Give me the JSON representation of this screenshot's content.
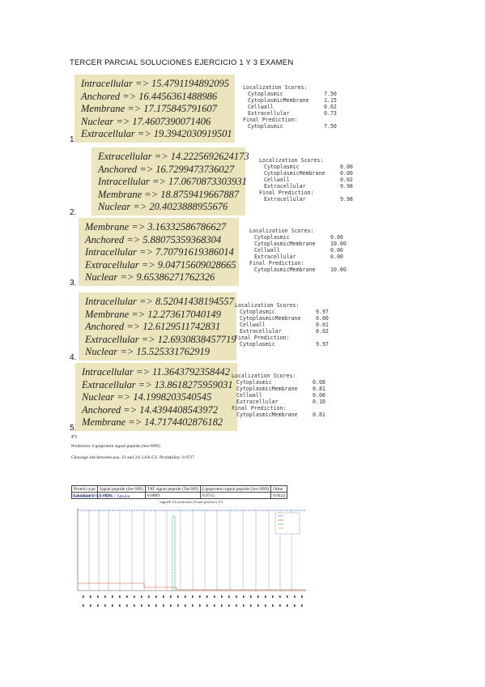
{
  "document": {
    "title": "TERCER PARCIAL SOLUCIONES EJERCICIO 1 Y 3 EXAMEN"
  },
  "questions": [
    {
      "number": "1.",
      "lines": [
        "Intracellular => 15.4791194892095",
        "Anchored => 16.4456361488986",
        "Membrane => 17.175845791607",
        "Nuclear => 17.4607390071406",
        "Extracellular => 19.3942030919501"
      ],
      "scores": {
        "header": "Localization Scores:",
        "rows": [
          [
            "Cytoplasmic",
            "7.50"
          ],
          [
            "CytoplasmicMembrane",
            "1.15"
          ],
          [
            "Cellwall",
            "0.62"
          ],
          [
            "Extracellular",
            "0.73"
          ]
        ],
        "final_label": "Final Prediction:",
        "final": [
          "Cytoplasmic",
          "7.50"
        ]
      }
    },
    {
      "number": "2.",
      "lines": [
        "Extracellular => 14.2225692624173",
        "Anchored => 16.7299473736027",
        "Intracellular => 17.0670873303931",
        "Membrane => 18.8759419667887",
        "Nuclear => 20.4023888955676"
      ],
      "scores": {
        "header": "Localization Scores:",
        "rows": [
          [
            "Cytoplasmic",
            "0.00"
          ],
          [
            "CytoplasmicMembrane",
            "0.00"
          ],
          [
            "Cellwall",
            "0.02"
          ],
          [
            "Extracellular",
            "9.98"
          ]
        ],
        "final_label": "Final Prediction:",
        "final": [
          "Extracellular",
          "9.98"
        ]
      }
    },
    {
      "number": "3.",
      "lines": [
        "Membrane => 3.16332586786627",
        "Anchored => 5.88075359368304",
        "Intracellular => 7.70791619386014",
        "Extracellular => 9.04715609028665",
        "Nuclear => 9.65386271762326"
      ],
      "scores": {
        "header": "Localization Scores:",
        "rows": [
          [
            "Cytoplasmic",
            "0.00"
          ],
          [
            "CytoplasmicMembrane",
            "10.00"
          ],
          [
            "Cellwall",
            "0.00"
          ],
          [
            "Extracellular",
            "0.00"
          ]
        ],
        "final_label": "Final Prediction:",
        "final": [
          "CytoplasmicMembrane",
          "10.00"
        ]
      }
    },
    {
      "number": "4.",
      "lines": [
        "Intracellular => 8.52041438194557",
        "Membrane => 12.273617040149",
        "Anchored => 12.6129511742831",
        "Extracellular => 12.6930838457719",
        "Nuclear => 15.525331762919"
      ],
      "scores": {
        "header": "Localization Scores:",
        "rows": [
          [
            "Cytoplasmic",
            "9.97"
          ],
          [
            "CytoplasmicMembrane",
            "0.00"
          ],
          [
            "Cellwall",
            "0.01"
          ],
          [
            "Extracellular",
            "0.02"
          ]
        ],
        "final_label": "Final Prediction:",
        "final": [
          "Cytoplasmic",
          "9.97"
        ]
      }
    },
    {
      "number": "5.",
      "lines": [
        "Intracellular => 11.3643792358442",
        "Extracellular => 13.8618275959031",
        "Nuclear => 14.1998203540545",
        "Anchored => 14.4394408543972",
        "Membrane => 14.7174402876182"
      ],
      "scores": {
        "header": "Localization Scores:",
        "rows": [
          [
            "Cytoplasmic",
            "0.08"
          ],
          [
            "CytoplasmicMembrane",
            "0.81"
          ],
          [
            "Cellwall",
            "0.00"
          ],
          [
            "Extracellular",
            "0.10"
          ]
        ],
        "final_label": "Final Prediction:",
        "final": [
          "CytoplasmicMembrane",
          "0.81"
        ]
      }
    }
  ],
  "signalp": {
    "section_label": "P3",
    "prediction": "Prediction: Lipoprotein signal peptide (Sec/SPII)",
    "cleavage": "Cleavage site between pos. 23 and 24: LSA-CS. Probability: 0.9727",
    "table": {
      "headers": [
        "Protein type",
        "Signal peptide (Sec/SPI)",
        "TAT signal peptide (Tat/SPI)",
        "Lipoprotein signal peptide (Sec/SPII)",
        "Other"
      ],
      "row_label": "Likelihood",
      "values": [
        "0.0094",
        "0.0069",
        "0.9715",
        "0.0122"
      ]
    },
    "downloads": "Download: PNG / EPS / Tabular",
    "plot_title": "SignalP-5.0 prediction (Gram-positive): P3"
  }
}
